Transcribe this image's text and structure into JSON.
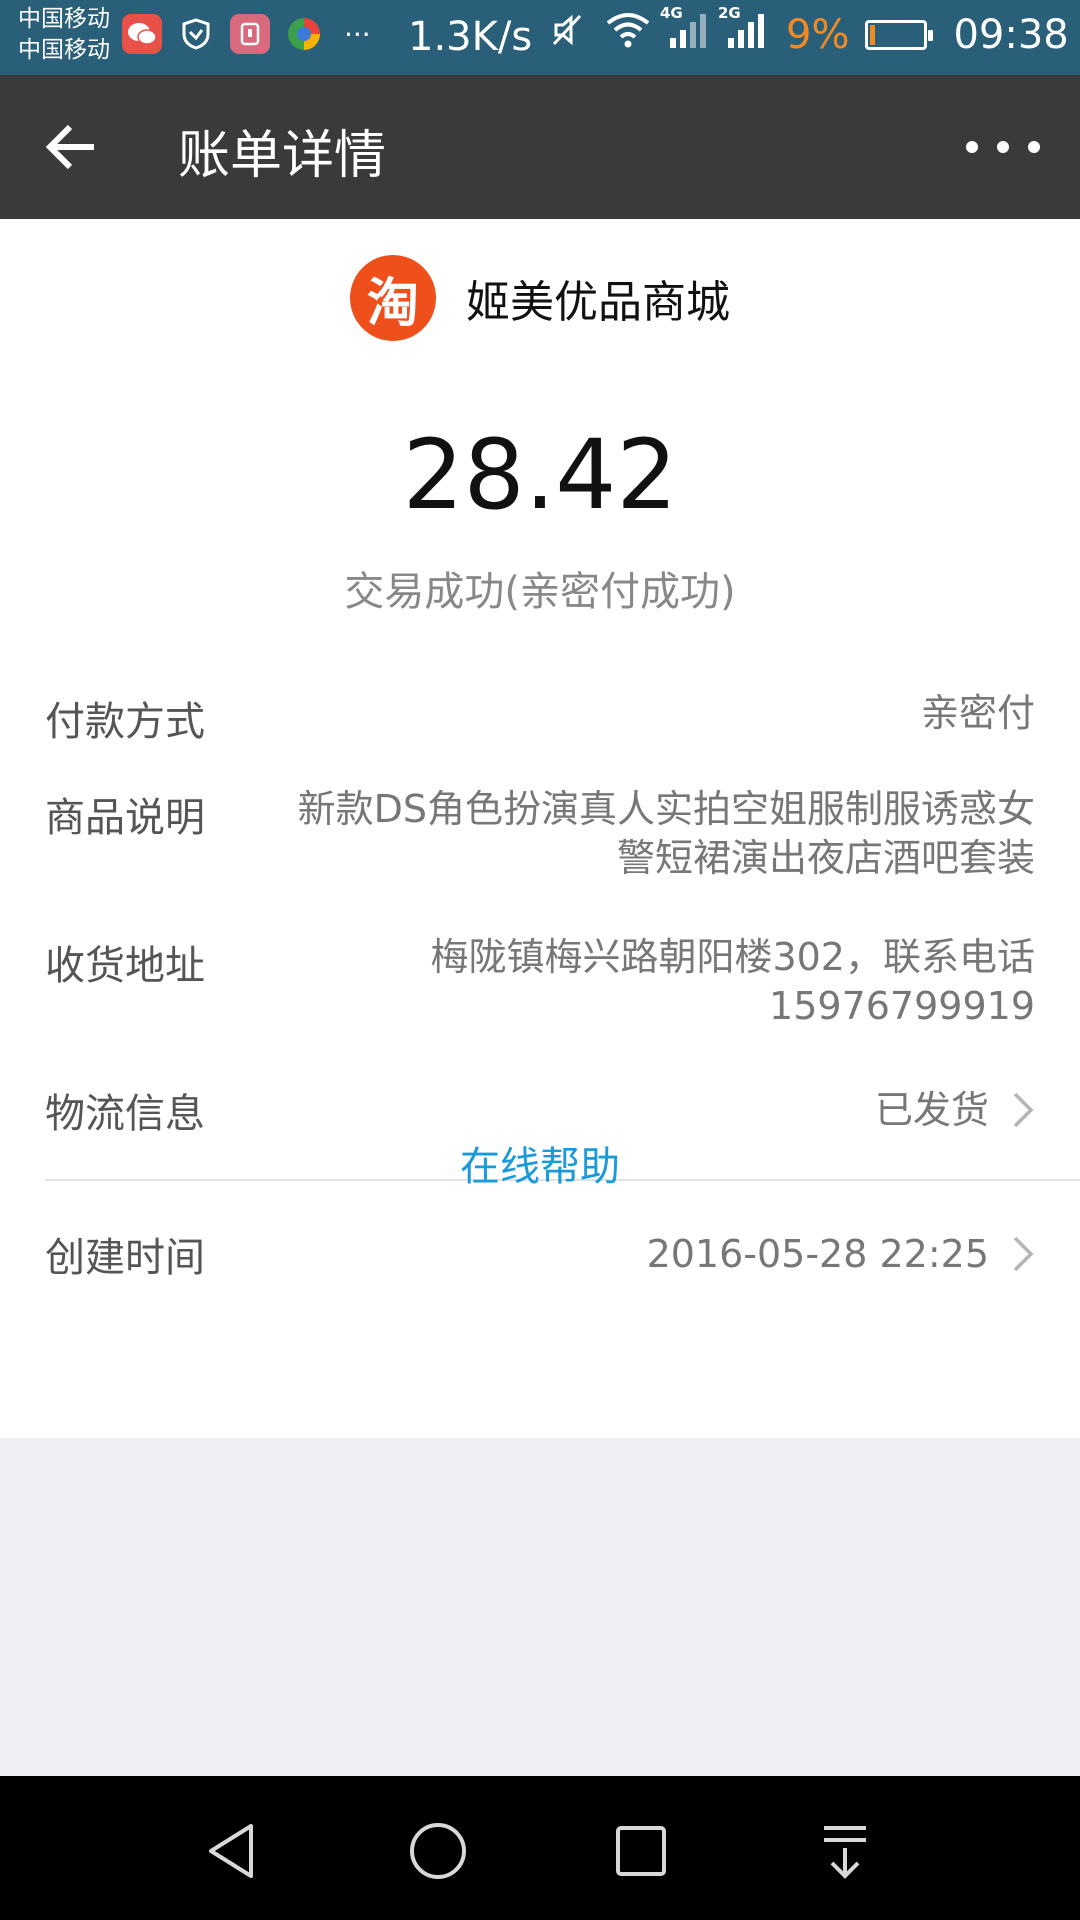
{
  "status_bar": {
    "carrier_1": "中国移动",
    "carrier_2": "中国移动",
    "more_notifications": "···",
    "net_speed": "1.3K/s",
    "net_type_1": "4G",
    "net_type_2": "2G",
    "battery_percent": "9%",
    "time": "09:38",
    "accent_color": "#f08a24"
  },
  "appbar": {
    "title": "账单详情",
    "back_icon": "arrow-left-icon",
    "more_icon": "more-dots-icon"
  },
  "merchant": {
    "logo_text": "淘",
    "name": "姬美优品商城",
    "logo_color": "#ef4f1b"
  },
  "transaction": {
    "amount": "28.42",
    "status": "交易成功(亲密付成功)"
  },
  "details": {
    "payment_method": {
      "label": "付款方式",
      "value": "亲密付"
    },
    "description": {
      "label": "商品说明",
      "value": "新款DS角色扮演真人实拍空姐服制服诱惑女警短裙演出夜店酒吧套装"
    },
    "address": {
      "label": "收货地址",
      "value": "梅陇镇梅兴路朝阳楼302，联系电话15976799919"
    },
    "logistics": {
      "label": "物流信息",
      "value": "已发货"
    },
    "created": {
      "label": "创建时间",
      "value": "2016-05-28 22:25"
    }
  },
  "help_link": {
    "label": "在线帮助",
    "color": "#1a9ad9"
  },
  "navbar": {
    "buttons": [
      "back-triangle-icon",
      "home-circle-icon",
      "recents-square-icon",
      "notification-pulldown-icon"
    ]
  }
}
